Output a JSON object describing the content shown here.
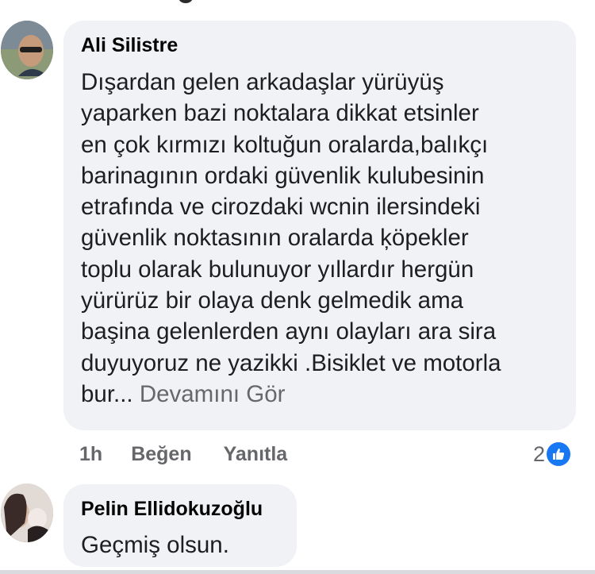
{
  "comments": [
    {
      "author": "Ali Silistre",
      "text": "Dışardan gelen arkadaşlar  yürüyüş\nyaparken bazi noktalara dikkat etsinler\nen çok kırmızı koltuğun oralarda,balıkçı\nbarinagının ordaki güvenlik kulubesinin\netrafında ve cirozdaki  wcnin ilersindeki\ngüvenlik noktasının oralarda ķöpekler\ntoplu olarak bulunuyor yıllardır hergün\nyürürüz bir olaya denk gelmedik ama\nbaşina gelenlerden aynı olayları ara sira\nduyuyoruz ne yazikki .Bisiklet ve motorla\nbur...",
      "see_more": "Devamını Gör",
      "time": "1h",
      "like_label": "Beğen",
      "reply_label": "Yanıtla",
      "reaction_count": "2",
      "reaction_icon": "like-icon"
    },
    {
      "author": "Pelin Ellidokuzoğlu",
      "text": "Geçmiş olsun."
    }
  ],
  "colors": {
    "bubble_bg": "#f0f2f5",
    "meta_text": "#65676b",
    "like_blue": "#1877f2"
  }
}
